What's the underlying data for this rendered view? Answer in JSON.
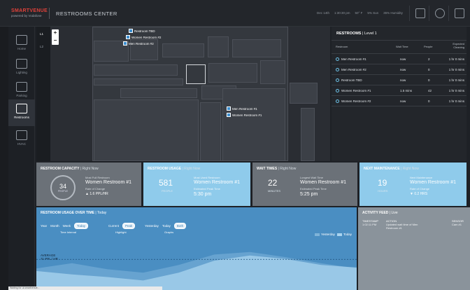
{
  "app": {
    "brand_red": "SMARTVENUE",
    "brand_sub": "powered by Vodafone",
    "title": "RESTROOMS CENTER",
    "date": "Dec 14th",
    "time": "1:30:30 pm",
    "temperature": "50° F",
    "wind": "5% Sun",
    "humidity": "35% Humidity"
  },
  "sidebar": {
    "items": [
      {
        "label": "Home",
        "icon": "home-icon"
      },
      {
        "label": "Lighting",
        "icon": "lighting-icon"
      },
      {
        "label": "Parking",
        "icon": "parking-icon"
      },
      {
        "label": "Restrooms",
        "icon": "restroom-icon"
      },
      {
        "label": "HVAC",
        "icon": "hvac-icon"
      }
    ]
  },
  "levels": [
    "L1",
    "L2"
  ],
  "map": {
    "zoom_in": "+",
    "zoom_out": "−",
    "pins": [
      "Restroom TBD",
      "Women Restroom #2",
      "Men Restroom #2",
      "Men Restroom #1",
      "Women Restroom #1"
    ]
  },
  "restrooms_panel": {
    "title": "RESTROOMS",
    "level": "Level 1",
    "columns": [
      "Restroom",
      "Wait Time",
      "People",
      "Expected Cleaning"
    ],
    "rows": [
      {
        "name": "Men Restroom #1",
        "wait": "now",
        "people": "2",
        "cleaning": "1 hr 0 mins"
      },
      {
        "name": "Men Restroom #2",
        "wait": "now",
        "people": "0",
        "cleaning": "1 hr 0 mins"
      },
      {
        "name": "Restroom TBD",
        "wait": "now",
        "people": "0",
        "cleaning": "1 hr 0 mins"
      },
      {
        "name": "Women Restroom #1",
        "wait": "1.5 mins",
        "people": "42",
        "cleaning": "1 hr 0 mins"
      },
      {
        "name": "Women Restroom #2",
        "wait": "now",
        "people": "0",
        "cleaning": "1 hr 0 mins"
      }
    ]
  },
  "cards": {
    "capacity": {
      "title": "RESTROOM CAPACITY",
      "sub": "Right Now",
      "value": "34",
      "unit": "PEOPLE",
      "label1": "Most Full Restroom",
      "value1": "Women Restroom #1",
      "label2": "Rate of Change",
      "value2": "▲ 1.6 PPL/HR"
    },
    "usage": {
      "title": "RESTROOM USAGE",
      "sub": "Right Now",
      "value": "581",
      "unit": "PEOPLE",
      "label1": "Most Used Restroom",
      "value1": "Women Restroom #1",
      "label2": "Estimated Peak Time",
      "value2": "5:30 pm"
    },
    "wait": {
      "title": "WAIT TIMES",
      "sub": "Right Now",
      "value": "22",
      "unit": "MINUTES",
      "label1": "Longest Wait Time",
      "value1": "Women Restroom #1",
      "label2": "Estimated Peak Time",
      "value2": "5:25 pm"
    },
    "maintenance": {
      "title": "NEXT MAINTENANCE",
      "sub": "Right Now",
      "value": "19",
      "unit": "HOURS",
      "label1": "Next Maintenance",
      "value1": "Women Restroom #1",
      "label2": "Rate of Change",
      "value2": "▼ 0.2 HRS"
    }
  },
  "usage_chart": {
    "title": "RESTROOM USAGE OVER TIME",
    "sub": "Today",
    "interval_options": [
      "Year",
      "Month",
      "Week",
      "Today"
    ],
    "interval_selected": "Today",
    "interval_label": "Time Interval",
    "highlight_options": [
      "Current",
      "Peak"
    ],
    "highlight_selected": "Peak",
    "highlight_label": "Highlight",
    "graph_options": [
      "Yesterday",
      "Today",
      "Both"
    ],
    "graph_selected": "Both",
    "graph_label": "Graphs",
    "legend_yesterday": "Yesterday",
    "legend_today": "Today",
    "average_label": "AVERAGE",
    "average_value": "71 PPL / HR"
  },
  "chart_data": {
    "type": "area",
    "title": "RESTROOM USAGE OVER TIME",
    "series": [
      {
        "name": "Yesterday",
        "values": [
          50,
          62,
          48,
          40,
          58,
          82,
          88,
          76,
          62,
          50
        ]
      },
      {
        "name": "Today",
        "values": [
          44,
          36,
          30,
          22,
          40,
          68,
          80,
          72,
          58,
          52
        ]
      }
    ],
    "average": 71,
    "ylim": [
      0,
      120
    ],
    "colors": {
      "yesterday": "#7fb3d8",
      "today": "#a9d4ef"
    }
  },
  "activity_feed": {
    "title": "ACTIVITY FEED",
    "sub": "Live",
    "columns": [
      "TIMESTAMP",
      "ACTION",
      "SENSOR"
    ],
    "entries": [
      {
        "timestamp": "1:02:11 PM",
        "action": "Updated wait time of Men Restroom #1",
        "sensor": "Cam #1"
      }
    ]
  },
  "statusbar": {
    "text": "Waiting for ui.smartvenue..."
  },
  "colors": {
    "background": "#1e2126",
    "capacity_card": "#6b7178",
    "usage_card": "#8fcbeb",
    "wait_card": "#6b7178",
    "maintenance_card": "#8fcbeb",
    "chart_bg": "#4a8ec2",
    "feed_bg": "#8a939b",
    "accent": "#e0413a"
  }
}
